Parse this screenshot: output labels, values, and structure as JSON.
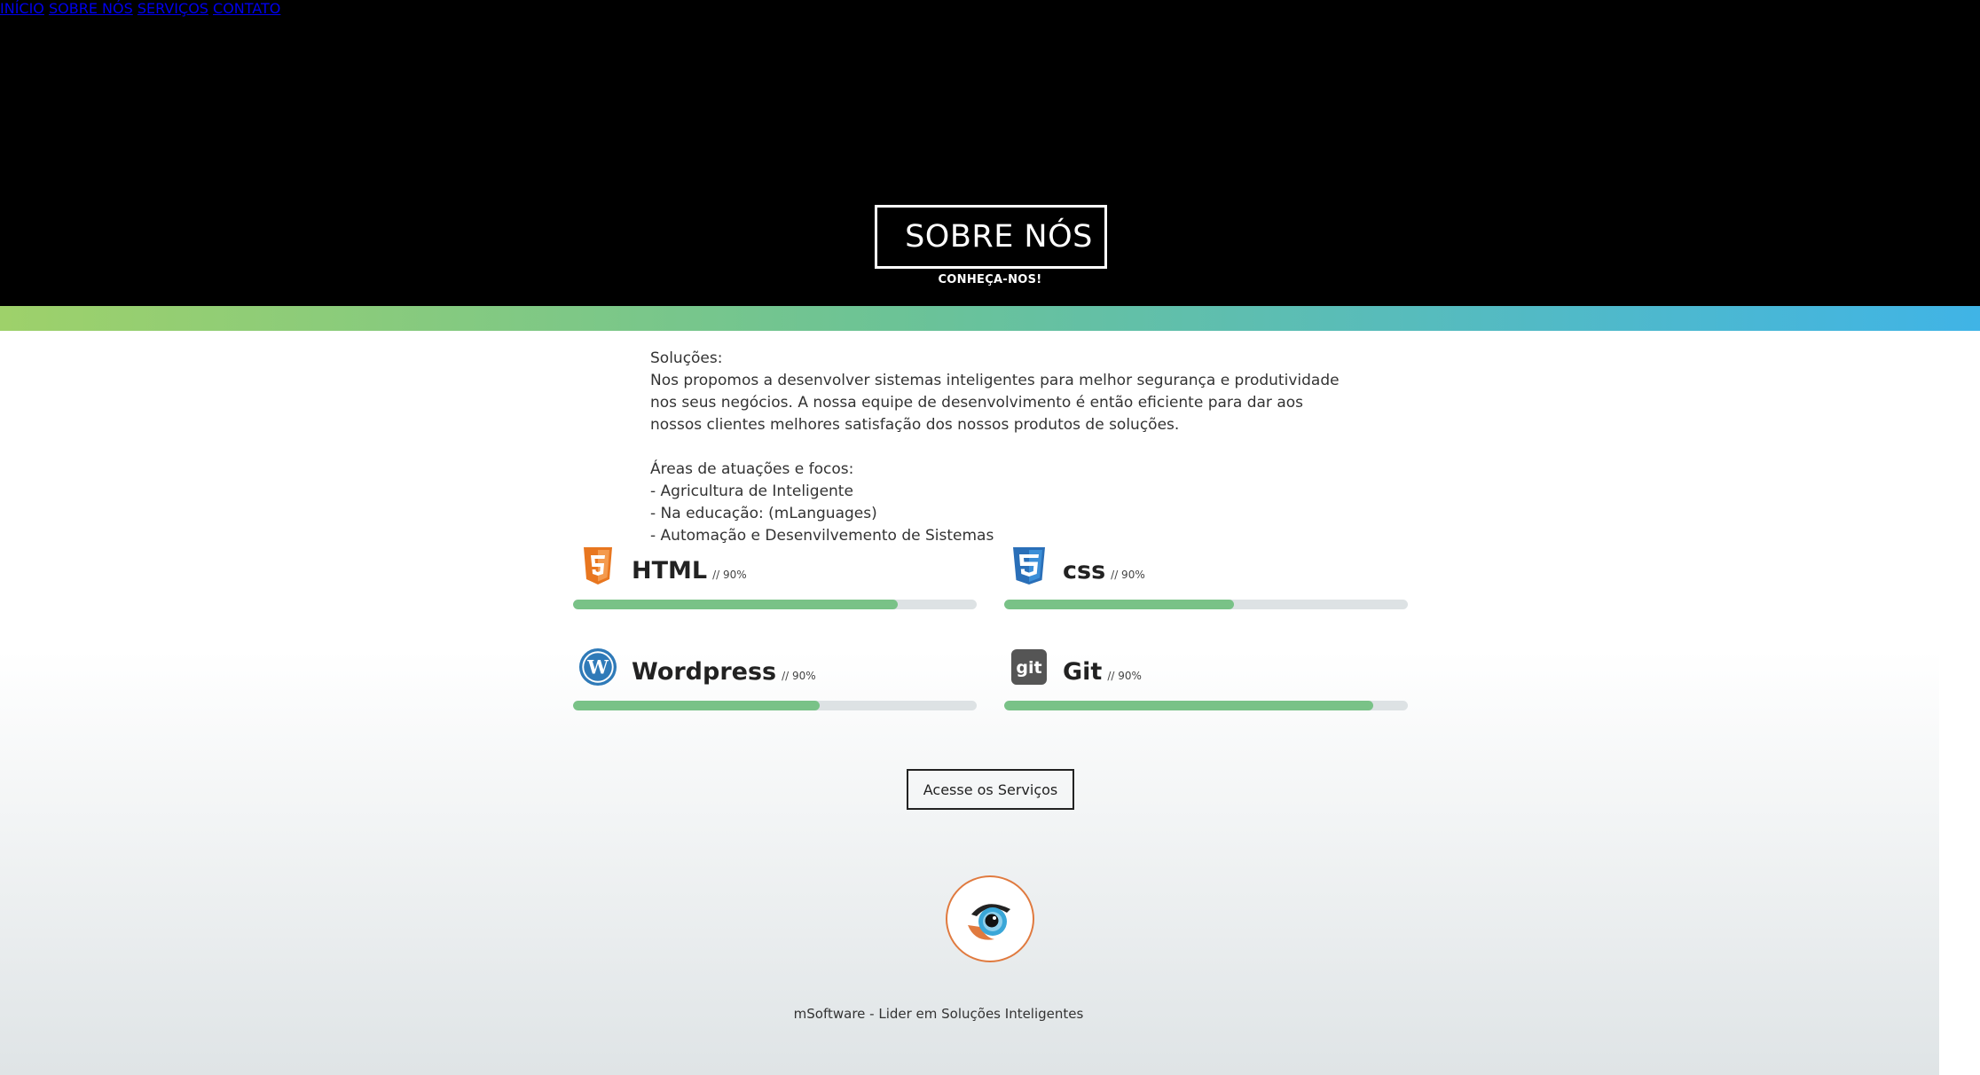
{
  "nav": {
    "items": [
      {
        "label": "INÍCIO"
      },
      {
        "label": "SOBRE NÓS"
      },
      {
        "label": "SERVIÇOS"
      },
      {
        "label": "CONTATO"
      }
    ]
  },
  "hero": {
    "title": "SOBRE NÓS",
    "subtitle": "CONHEÇA-NOS!"
  },
  "content": {
    "heading": "Soluções:",
    "paragraph": "Nos propomos a desenvolver sistemas inteligentes para melhor segurança e produtividade nos seus negócios. A nossa equipe de desenvolvimento é então eficiente para dar aos nossos clientes melhores satisfação dos nossos produtos de soluções.",
    "areas_heading": "Áreas de atuações e focos:",
    "areas": [
      "- Agricultura de Inteligente",
      "- Na educação: (mLanguages)",
      "- Automação e Desenvilvemento de Sistemas"
    ]
  },
  "skills": [
    {
      "name": "HTML",
      "percent_label": "// 90%",
      "icon": "html5-icon",
      "progress": 0.805,
      "color": "#e8761f"
    },
    {
      "name": "css",
      "percent_label": "// 90%",
      "icon": "css3-icon",
      "progress": 0.57,
      "color": "#2a6fb8"
    },
    {
      "name": "Wordpress",
      "percent_label": "// 90%",
      "icon": "wordpress-icon",
      "progress": 0.61,
      "color": "#2f7ab8"
    },
    {
      "name": "Git",
      "percent_label": "// 90%",
      "icon": "git-icon",
      "progress": 0.915,
      "color": "#555555"
    }
  ],
  "colors": {
    "progress_fill": "#79c287",
    "progress_track": "#dde2e4",
    "gradient_start": "#9ed16a",
    "gradient_end": "#40b4e6",
    "logo_ring": "#e07a3f"
  },
  "cta": {
    "label": "Acesse os Serviços"
  },
  "logo": {
    "icon": "eye-logo-icon"
  },
  "footer": {
    "text": "mSoftware - Lider em Soluções Inteligentes"
  }
}
